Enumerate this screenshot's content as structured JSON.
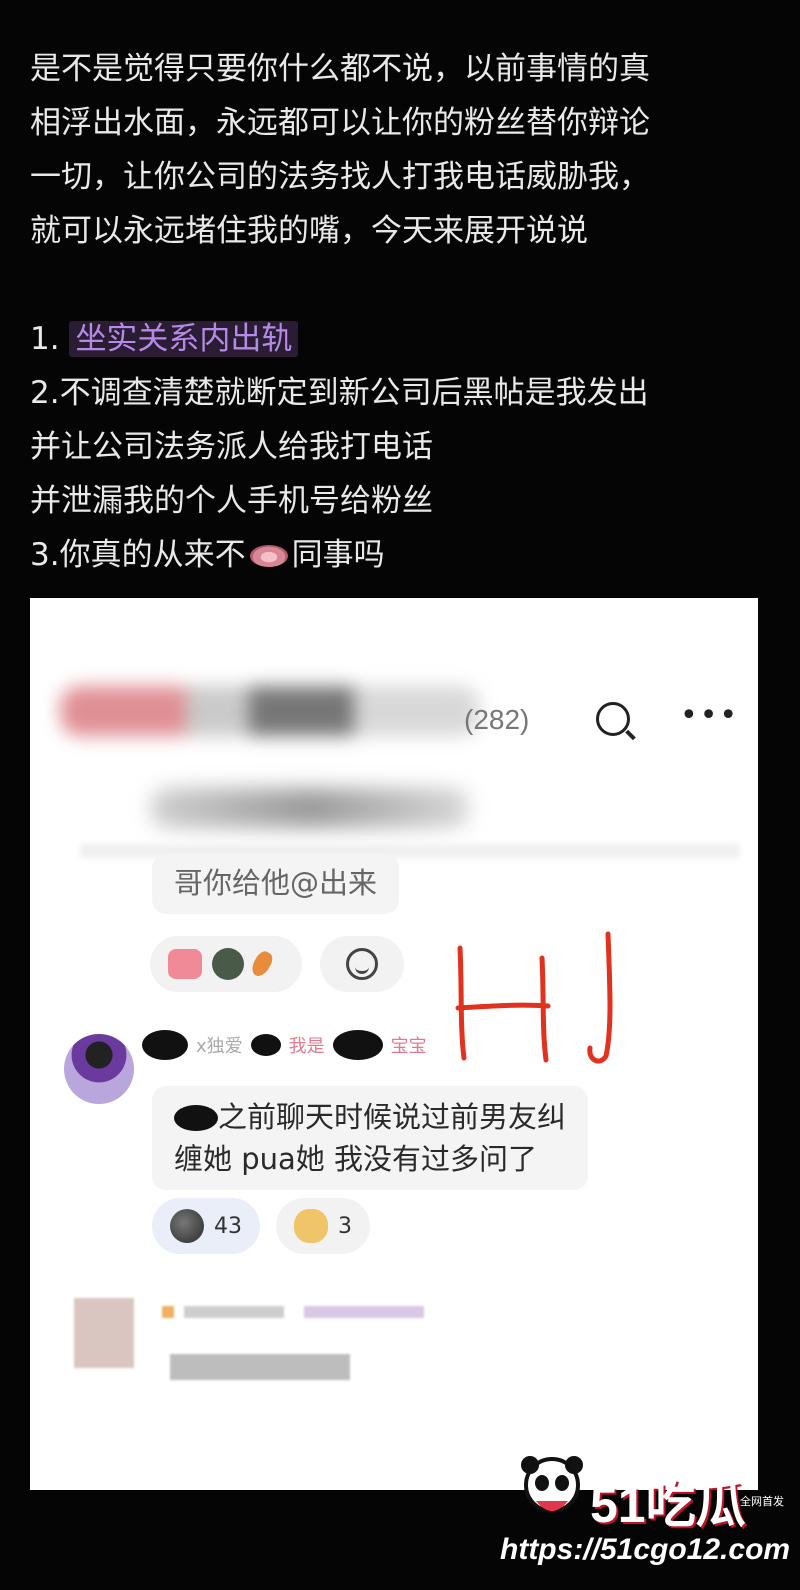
{
  "post": {
    "para1_line1": "是不是觉得只要你什么都不说，以前事情的真",
    "para1_line2": "相浮出水面，永远都可以让你的粉丝替你辩论",
    "para1_line3": "一切，让你公司的法务找人打我电话威胁我，",
    "para1_line4": "就可以永远堵住我的嘴，今天来展开说说",
    "item1_num": "1.",
    "item1_highlight": "坐实关系内出轨",
    "item2_line1": "2.不调查清楚就断定到新公司后黑帖是我发出",
    "item2_line2": "并让公司法务派人给我打电话",
    "item2_line3": "并泄漏我的个人手机号给粉丝",
    "item3_pre": "3.你真的从来不",
    "item3_post": "同事吗"
  },
  "screenshot": {
    "member_count": "(282)",
    "comment1": "哥你给他@出来",
    "name_fragment": "x独爱",
    "tag_fragment_a": "我是",
    "tag_fragment_b": "宝宝",
    "comment2_line1": "之前聊天时候说过前男友纠",
    "comment2_line2": "缠她 pua她 我没有过多问了",
    "reaction1_count": "43",
    "reaction2_count": "3",
    "handwritten": "HJ"
  },
  "watermark": {
    "brand": "51吃瓜",
    "small": "全网首发",
    "url": "https://51cgo12.com"
  },
  "icons": [
    "search-icon",
    "more-icon",
    "thumbs-up-icon",
    "emoji-add-icon",
    "moon-face-icon",
    "cat-face-icon",
    "lips-icon"
  ],
  "colors": {
    "highlight_text": "#b58ae6",
    "handwriting": "#e0321e",
    "background": "#050505"
  }
}
